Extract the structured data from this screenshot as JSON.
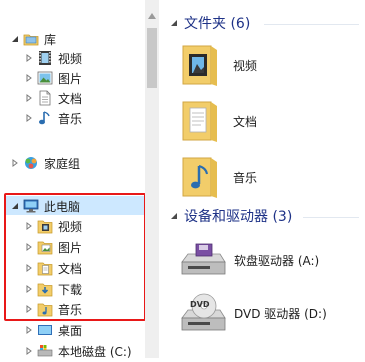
{
  "nav": {
    "libraries": {
      "label": "库",
      "children": [
        {
          "label": "视频",
          "icon": "video-library-icon"
        },
        {
          "label": "图片",
          "icon": "picture-library-icon"
        },
        {
          "label": "文档",
          "icon": "document-library-icon"
        },
        {
          "label": "音乐",
          "icon": "music-library-icon"
        }
      ]
    },
    "homegroup": {
      "label": "家庭组"
    },
    "this_pc": {
      "label": "此电脑",
      "children": [
        {
          "label": "视频"
        },
        {
          "label": "图片"
        },
        {
          "label": "文档"
        },
        {
          "label": "下载"
        },
        {
          "label": "音乐"
        },
        {
          "label": "桌面"
        },
        {
          "label": "本地磁盘 (C:)"
        }
      ]
    }
  },
  "content": {
    "folders": {
      "header": "文件夹 (6)",
      "items": [
        {
          "label": "视频"
        },
        {
          "label": "文档"
        },
        {
          "label": "音乐"
        }
      ]
    },
    "devices": {
      "header": "设备和驱动器 (3)",
      "items": [
        {
          "label": "软盘驱动器 (A:)"
        },
        {
          "label": "DVD 驱动器 (D:)"
        }
      ]
    }
  },
  "colors": {
    "highlight_border": "#e81818",
    "selection": "#cde8ff",
    "group_header": "#1e3287",
    "folder": "#f2cd6a"
  }
}
